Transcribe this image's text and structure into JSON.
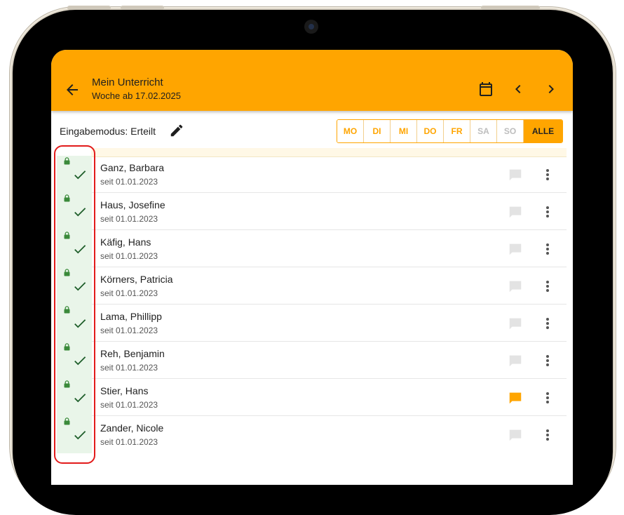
{
  "appbar": {
    "title": "Mein Unterricht",
    "subtitle": "Woche ab 17.02.2025",
    "icons": {
      "back": "arrow-back-icon",
      "calendar": "calendar-icon",
      "prev": "chevron-left-icon",
      "next": "chevron-right-icon"
    }
  },
  "mode": {
    "label": "Eingabemodus: Erteilt",
    "icon": "pencil-icon"
  },
  "day_filter": {
    "days": [
      "MO",
      "DI",
      "MI",
      "DO",
      "FR",
      "SA",
      "SO"
    ],
    "all_label": "ALLE",
    "selected": "ALLE"
  },
  "students": [
    {
      "name": "Ganz, Barbara",
      "since": "seit 01.01.2023",
      "has_comment": false
    },
    {
      "name": "Haus, Josefine",
      "since": "seit 01.01.2023",
      "has_comment": false
    },
    {
      "name": "Käfig, Hans",
      "since": "seit 01.01.2023",
      "has_comment": false
    },
    {
      "name": "Körners, Patricia",
      "since": "seit 01.01.2023",
      "has_comment": false
    },
    {
      "name": "Lama, Phillipp",
      "since": "seit 01.01.2023",
      "has_comment": false
    },
    {
      "name": "Reh, Benjamin",
      "since": "seit 01.01.2023",
      "has_comment": false
    },
    {
      "name": "Stier, Hans",
      "since": "seit 01.01.2023",
      "has_comment": true
    },
    {
      "name": "Zander, Nicole",
      "since": "seit 01.01.2023",
      "has_comment": false
    }
  ],
  "row_icons": {
    "status": "check-icon",
    "lock": "lock-icon",
    "comment": "comment-icon",
    "menu": "more-vert-icon"
  },
  "colors": {
    "accent": "#FFA500",
    "status_bg": "#e9f5e9",
    "check": "#1e5e2a",
    "lock": "#3a8a3a",
    "comment_inactive": "#e3e3e3",
    "comment_active": "#FFA500",
    "highlight": "#e21b1b"
  }
}
